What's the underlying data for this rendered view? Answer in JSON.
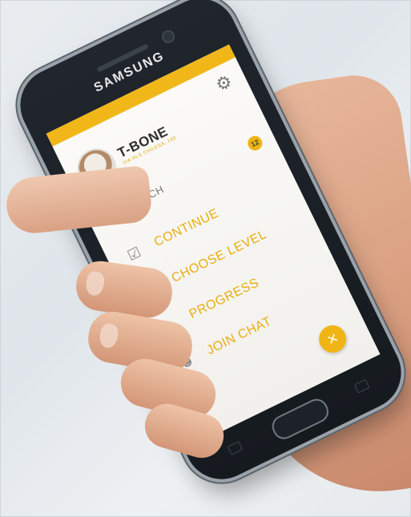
{
  "device": {
    "brand": "SAMSUNG"
  },
  "app": {
    "colors": {
      "accent": "#f0b514",
      "status_bar": "#f1b718",
      "text_dark": "#2f2f2f",
      "muted": "#777777"
    },
    "profile": {
      "name": "T-BONE",
      "subtitle": "VIA HLS CHILESA, 140"
    },
    "search": {
      "label": "SEARCH",
      "badge_count": "12"
    },
    "menu": [
      {
        "label": "CONTINUE",
        "icon": "clipboard-check-icon"
      },
      {
        "label": "CHOOSE LEVEL",
        "icon": "calendar-icon"
      },
      {
        "label": "PROGRESS",
        "icon": "line-chart-icon"
      },
      {
        "label": "JOIN CHAT",
        "icon": "add-user-icon"
      }
    ],
    "fab_symbol": "×"
  }
}
